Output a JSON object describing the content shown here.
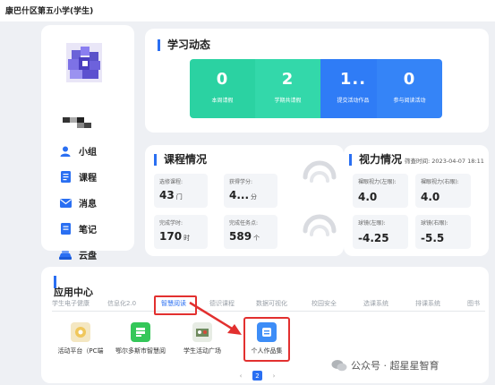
{
  "header": {
    "school_name": "康巴什区第五小学(学生)"
  },
  "sidebar": {
    "items": [
      {
        "label": "小组",
        "icon": "user-icon"
      },
      {
        "label": "课程",
        "icon": "course-doc-icon"
      },
      {
        "label": "消息",
        "icon": "mail-icon"
      },
      {
        "label": "笔记",
        "icon": "note-icon"
      },
      {
        "label": "云盘",
        "icon": "cloud-disk-icon"
      }
    ]
  },
  "learning": {
    "title": "学习动态",
    "tiles": [
      {
        "value": "0",
        "caption": "本周请假",
        "color": "#2bd2a2"
      },
      {
        "value": "2",
        "caption": "学期共请假",
        "color": "#2bd2a2"
      },
      {
        "value": "1..",
        "caption": "提交活动作品",
        "color": "#2f7cf6"
      },
      {
        "value": "0",
        "caption": "参与阅读活动",
        "color": "#2f7cf6"
      }
    ]
  },
  "course": {
    "title": "课程情况",
    "stats": [
      {
        "label": "选修课程:",
        "value": "43",
        "unit": "门"
      },
      {
        "label": "获得学分:",
        "value": "4...",
        "unit": "分"
      },
      {
        "label": "完成学时:",
        "value": "170",
        "unit": "时"
      },
      {
        "label": "完成任务点:",
        "value": "589",
        "unit": "个"
      }
    ]
  },
  "vision": {
    "title": "视力情况",
    "screen_time_label": "筛查时间:",
    "screen_time": "2023-04-07 18:11",
    "stats": [
      {
        "label": "裸眼视力(左眼):",
        "value": "4.0"
      },
      {
        "label": "裸眼视力(右眼):",
        "value": "4.0"
      },
      {
        "label": "球镜(左眼):",
        "value": "-4.25"
      },
      {
        "label": "球镜(右眼):",
        "value": "-5.5"
      }
    ]
  },
  "app_center": {
    "title": "应用中心",
    "categories": [
      "学生电子健康",
      "信息化2.0",
      "智慧阅读",
      "德识课程",
      "数据可视化",
      "校园安全",
      "选课系统",
      "排课系统",
      "图书"
    ],
    "active_category": "智慧阅读",
    "apps": [
      {
        "name": "活动平台（PC端",
        "color": "#f4e7c2"
      },
      {
        "name": "鄂尔多斯市智慧阅",
        "color": "#34c759"
      },
      {
        "name": "学生活动广场",
        "color": "#e7ece4"
      },
      {
        "name": "个人作品集",
        "color": "#3d8df7"
      }
    ],
    "pager": {
      "prev": "‹",
      "current": "2",
      "next": "›"
    }
  },
  "watermark": {
    "text": "公众号 · 超星星智育"
  }
}
